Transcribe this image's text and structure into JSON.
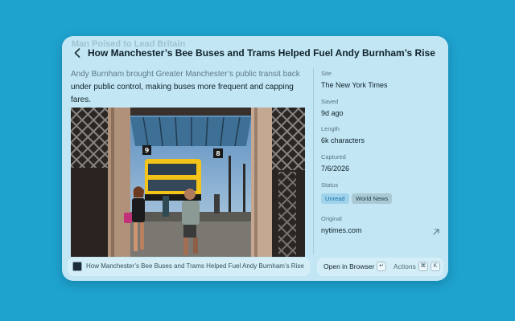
{
  "article": {
    "ghost_title": "Man Poised to Lead Britain",
    "title": "How Manchester’s Bee Buses and Trams Helped Fuel Andy Burnham’s Rise",
    "description_faded": "Andy Burnham brought Greater Manchester’s public transit back",
    "description_rest": "under public control, making buses more frequent and capping fares."
  },
  "photo": {
    "bus_sign_left": "9",
    "bus_sign_right": "8"
  },
  "meta": {
    "site_label": "Site",
    "site_value": "The New York Times",
    "saved_label": "Saved",
    "saved_value": "9d ago",
    "length_label": "Length",
    "length_value": "6k characters",
    "captured_label": "Captured",
    "captured_value": "7/6/2026",
    "status_label": "Status",
    "status_badges": [
      "Unread",
      "World News"
    ],
    "original_label": "Original",
    "original_value": "nytimes.com"
  },
  "footer": {
    "tab_title": "How Manchester’s Bee Buses and Trams Helped Fuel Andy Burnham’s Rise",
    "open_label": "Open in Browser",
    "open_key": "↵",
    "actions_label": "Actions",
    "actions_keys": [
      "⌘",
      "K"
    ]
  },
  "colors": {
    "background": "#1ea3cf",
    "panel": "#c2e6f3",
    "unread_badge": "#9fd3ec",
    "topic_badge": "#a9c9d4"
  },
  "icons": [
    "chevron-left-icon",
    "external-link-icon",
    "favicon-icon"
  ]
}
